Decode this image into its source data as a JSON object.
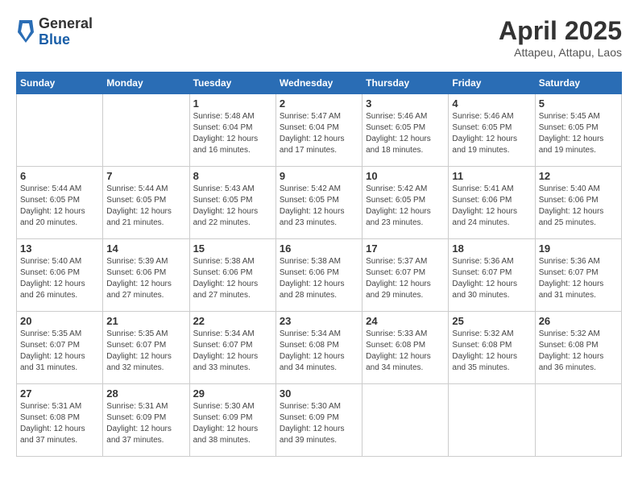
{
  "header": {
    "logo_general": "General",
    "logo_blue": "Blue",
    "month_title": "April 2025",
    "subtitle": "Attapeu, Attapu, Laos"
  },
  "weekdays": [
    "Sunday",
    "Monday",
    "Tuesday",
    "Wednesday",
    "Thursday",
    "Friday",
    "Saturday"
  ],
  "weeks": [
    [
      {
        "day": "",
        "info": ""
      },
      {
        "day": "",
        "info": ""
      },
      {
        "day": "1",
        "info": "Sunrise: 5:48 AM\nSunset: 6:04 PM\nDaylight: 12 hours and 16 minutes."
      },
      {
        "day": "2",
        "info": "Sunrise: 5:47 AM\nSunset: 6:04 PM\nDaylight: 12 hours and 17 minutes."
      },
      {
        "day": "3",
        "info": "Sunrise: 5:46 AM\nSunset: 6:05 PM\nDaylight: 12 hours and 18 minutes."
      },
      {
        "day": "4",
        "info": "Sunrise: 5:46 AM\nSunset: 6:05 PM\nDaylight: 12 hours and 19 minutes."
      },
      {
        "day": "5",
        "info": "Sunrise: 5:45 AM\nSunset: 6:05 PM\nDaylight: 12 hours and 19 minutes."
      }
    ],
    [
      {
        "day": "6",
        "info": "Sunrise: 5:44 AM\nSunset: 6:05 PM\nDaylight: 12 hours and 20 minutes."
      },
      {
        "day": "7",
        "info": "Sunrise: 5:44 AM\nSunset: 6:05 PM\nDaylight: 12 hours and 21 minutes."
      },
      {
        "day": "8",
        "info": "Sunrise: 5:43 AM\nSunset: 6:05 PM\nDaylight: 12 hours and 22 minutes."
      },
      {
        "day": "9",
        "info": "Sunrise: 5:42 AM\nSunset: 6:05 PM\nDaylight: 12 hours and 23 minutes."
      },
      {
        "day": "10",
        "info": "Sunrise: 5:42 AM\nSunset: 6:05 PM\nDaylight: 12 hours and 23 minutes."
      },
      {
        "day": "11",
        "info": "Sunrise: 5:41 AM\nSunset: 6:06 PM\nDaylight: 12 hours and 24 minutes."
      },
      {
        "day": "12",
        "info": "Sunrise: 5:40 AM\nSunset: 6:06 PM\nDaylight: 12 hours and 25 minutes."
      }
    ],
    [
      {
        "day": "13",
        "info": "Sunrise: 5:40 AM\nSunset: 6:06 PM\nDaylight: 12 hours and 26 minutes."
      },
      {
        "day": "14",
        "info": "Sunrise: 5:39 AM\nSunset: 6:06 PM\nDaylight: 12 hours and 27 minutes."
      },
      {
        "day": "15",
        "info": "Sunrise: 5:38 AM\nSunset: 6:06 PM\nDaylight: 12 hours and 27 minutes."
      },
      {
        "day": "16",
        "info": "Sunrise: 5:38 AM\nSunset: 6:06 PM\nDaylight: 12 hours and 28 minutes."
      },
      {
        "day": "17",
        "info": "Sunrise: 5:37 AM\nSunset: 6:07 PM\nDaylight: 12 hours and 29 minutes."
      },
      {
        "day": "18",
        "info": "Sunrise: 5:36 AM\nSunset: 6:07 PM\nDaylight: 12 hours and 30 minutes."
      },
      {
        "day": "19",
        "info": "Sunrise: 5:36 AM\nSunset: 6:07 PM\nDaylight: 12 hours and 31 minutes."
      }
    ],
    [
      {
        "day": "20",
        "info": "Sunrise: 5:35 AM\nSunset: 6:07 PM\nDaylight: 12 hours and 31 minutes."
      },
      {
        "day": "21",
        "info": "Sunrise: 5:35 AM\nSunset: 6:07 PM\nDaylight: 12 hours and 32 minutes."
      },
      {
        "day": "22",
        "info": "Sunrise: 5:34 AM\nSunset: 6:07 PM\nDaylight: 12 hours and 33 minutes."
      },
      {
        "day": "23",
        "info": "Sunrise: 5:34 AM\nSunset: 6:08 PM\nDaylight: 12 hours and 34 minutes."
      },
      {
        "day": "24",
        "info": "Sunrise: 5:33 AM\nSunset: 6:08 PM\nDaylight: 12 hours and 34 minutes."
      },
      {
        "day": "25",
        "info": "Sunrise: 5:32 AM\nSunset: 6:08 PM\nDaylight: 12 hours and 35 minutes."
      },
      {
        "day": "26",
        "info": "Sunrise: 5:32 AM\nSunset: 6:08 PM\nDaylight: 12 hours and 36 minutes."
      }
    ],
    [
      {
        "day": "27",
        "info": "Sunrise: 5:31 AM\nSunset: 6:08 PM\nDaylight: 12 hours and 37 minutes."
      },
      {
        "day": "28",
        "info": "Sunrise: 5:31 AM\nSunset: 6:09 PM\nDaylight: 12 hours and 37 minutes."
      },
      {
        "day": "29",
        "info": "Sunrise: 5:30 AM\nSunset: 6:09 PM\nDaylight: 12 hours and 38 minutes."
      },
      {
        "day": "30",
        "info": "Sunrise: 5:30 AM\nSunset: 6:09 PM\nDaylight: 12 hours and 39 minutes."
      },
      {
        "day": "",
        "info": ""
      },
      {
        "day": "",
        "info": ""
      },
      {
        "day": "",
        "info": ""
      }
    ]
  ]
}
